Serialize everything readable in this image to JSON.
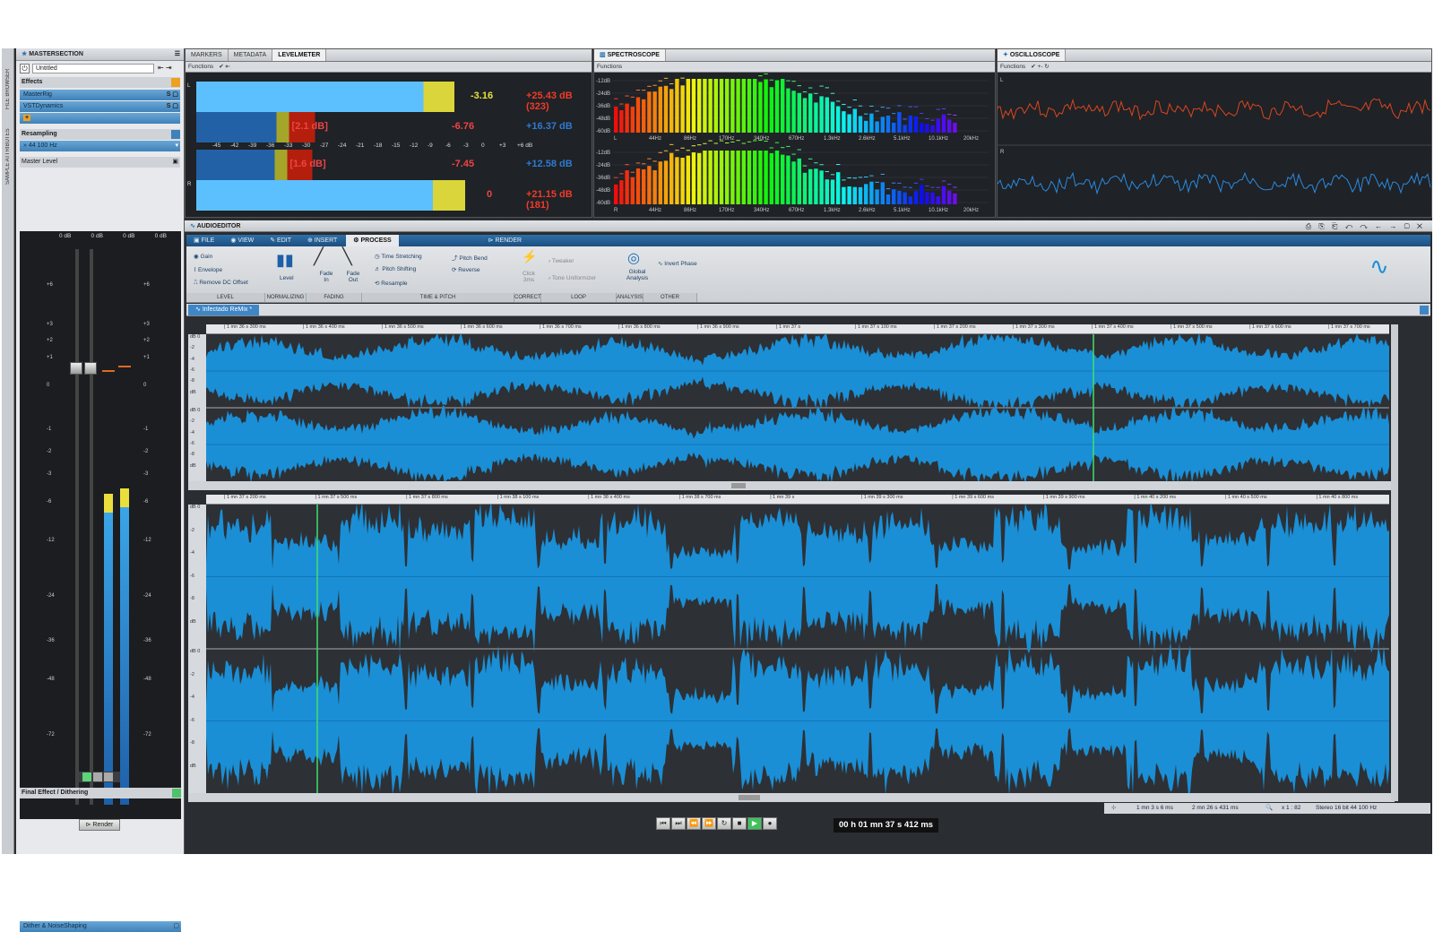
{
  "side_tabs": [
    "FILE BROWSER",
    "SAMPLE ATTRIBUTES"
  ],
  "master_section": {
    "title": "MASTERSECTION",
    "preset": "Untitled",
    "effects_label": "Effects",
    "slots": [
      "MasterRig",
      "VSTDynamics"
    ],
    "resampling_label": "Resampling",
    "resampling_value": "44 100 Hz",
    "master_level_label": "Master Level",
    "channel_readouts": [
      "0 dB",
      "0 dB",
      "0 dB",
      "0 dB"
    ],
    "fader_scale": [
      "+6",
      "+3",
      "+2",
      "+1",
      "0",
      "-1",
      "-2",
      "-3",
      "-6",
      "-12",
      "-24",
      "-36",
      "-48",
      "-72"
    ],
    "final_effect_label": "Final Effect / Dithering",
    "dither_label": "Dither & NoiseShaping",
    "render_label": "Render",
    "meter_levels": [
      0.56,
      0.57
    ]
  },
  "level_meter": {
    "tabs": [
      "MARKERS",
      "METADATA",
      "LEVELMETER"
    ],
    "functions_label": "Functions",
    "rows": [
      {
        "peak": "-3.16",
        "max": "+25.43 dB (323)",
        "level": 0.96,
        "peak_color": "#e7e03b"
      },
      {
        "peak": "-6.76",
        "max": "+16.37 dB",
        "bracket": "[2.1 dB]",
        "level": 0.48
      },
      {
        "peak": "-7.45",
        "max": "+12.58 dB",
        "bracket": "[1.6 dB]",
        "level": 0.47
      },
      {
        "peak": "0",
        "max": "+21.15 dB (181)",
        "level": 1.0
      }
    ],
    "scale": [
      "-45",
      "-42",
      "-39",
      "-36",
      "-33",
      "-30",
      "-27",
      "-24",
      "-21",
      "-18",
      "-15",
      "-12",
      "-9",
      "-6",
      "-3",
      "0",
      "+3",
      "+6 dB"
    ],
    "channel_labels": [
      "L",
      "R"
    ]
  },
  "spectroscope": {
    "title": "SPECTROSCOPE",
    "functions_label": "Functions",
    "db_labels": [
      "-12dB",
      "-24dB",
      "-36dB",
      "-48dB",
      "-60dB"
    ],
    "freq_labels": [
      "L",
      "44Hz",
      "86Hz",
      "170Hz",
      "340Hz",
      "670Hz",
      "1.3kHz",
      "2.6kHz",
      "5.1kHz",
      "10.1kHz",
      "20kHz"
    ],
    "freq_labels_r": [
      "R",
      "44Hz",
      "86Hz",
      "170Hz",
      "340Hz",
      "670Hz",
      "1.3kHz",
      "2.6kHz",
      "5.1kHz",
      "10.1kHz",
      "20kHz"
    ]
  },
  "oscilloscope": {
    "title": "OSCILLOSCOPE",
    "functions_label": "Functions",
    "channel_labels": [
      "L",
      "R"
    ]
  },
  "audio_editor": {
    "title": "AUDIOEDITOR",
    "ribbon_tabs": [
      "FILE",
      "VIEW",
      "EDIT",
      "INSERT",
      "PROCESS",
      "RENDER"
    ],
    "level_items": [
      "Gain",
      "Envelope",
      "Remove DC Offset"
    ],
    "normalizing_item": "Level",
    "fade_items": [
      "Fade In",
      "Fade Out"
    ],
    "time_pitch_items": [
      "Time Stretching",
      "Pitch Shifting",
      "Resample",
      "Pitch Bend",
      "Reverse"
    ],
    "correct_item": "Click 3ms",
    "loop_items": [
      "Tweaker",
      "Tone Uniformizer"
    ],
    "analysis_item": "Global Analysis",
    "other_item": "Invert Phase",
    "group_labels": [
      "LEVEL",
      "NORMALIZING",
      "FADING",
      "TIME & PITCH",
      "CORRECT",
      "LOOP",
      "ANALYSIS",
      "OTHER"
    ],
    "file_tab": "Infectado ReMix *",
    "ruler_top": [
      "1 mn 36 s 300 ms",
      "1 mn 36 s 400 ms",
      "1 mn 36 s 500 ms",
      "1 mn 36 s 600 ms",
      "1 mn 36 s 700 ms",
      "1 mn 36 s 800 ms",
      "1 mn 36 s 900 ms",
      "1 mn 37 s",
      "1 mn 37 s 100 ms",
      "1 mn 37 s 200 ms",
      "1 mn 37 s 300 ms",
      "1 mn 37 s 400 ms",
      "1 mn 37 s 500 ms",
      "1 mn 37 s 600 ms",
      "1 mn 37 s 700 ms"
    ],
    "ruler_bottom": [
      "1 mn 37 s 200 ms",
      "1 mn 37 s 500 ms",
      "1 mn 37 s 800 ms",
      "1 mn 38 s 100 ms",
      "1 mn 38 s 400 ms",
      "1 mn 38 s 700 ms",
      "1 mn 39 s",
      "1 mn 39 s 300 ms",
      "1 mn 39 s 600 ms",
      "1 mn 39 s 900 ms",
      "1 mn 40 s 200 ms",
      "1 mn 40 s 500 ms",
      "1 mn 40 s 800 ms"
    ],
    "db_axis": [
      "dB 0",
      "-2",
      "-4",
      "-6",
      "-8",
      "dB"
    ],
    "status": {
      "selection": "1 mn 3 s 6 ms",
      "length": "2 mn 26 s 431 ms",
      "zoom": "x 1 : 82",
      "format": "Stereo 16 bit 44 100 Hz"
    },
    "time_display": "00 h 01 mn 37 s 412 ms",
    "colors": {
      "waveform": "#1a8fd6",
      "cursor": "#3fe06b",
      "background": "#2d3035"
    }
  }
}
